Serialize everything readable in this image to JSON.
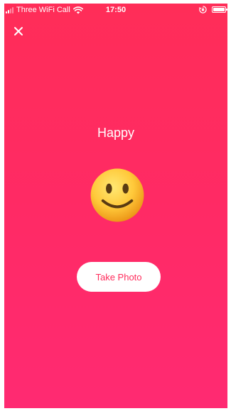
{
  "status_bar": {
    "carrier": "Three WiFi Call",
    "time": "17:50",
    "signal_bars": 4,
    "signal_active": 2,
    "battery_level": 1.0,
    "icons": [
      "signal-icon",
      "wifi-icon",
      "rotation-lock-icon",
      "battery-icon"
    ]
  },
  "toolbar": {
    "close_icon": "close-icon"
  },
  "main": {
    "mood_label": "Happy",
    "emoji": "slightly-smiling-face",
    "take_photo_label": "Take Photo"
  },
  "colors": {
    "background_top": "#ff2d58",
    "background_bottom": "#ff2a72",
    "button_background": "#ffffff",
    "button_text": "#ff2d5c",
    "emoji_face": "#ffc93a"
  }
}
